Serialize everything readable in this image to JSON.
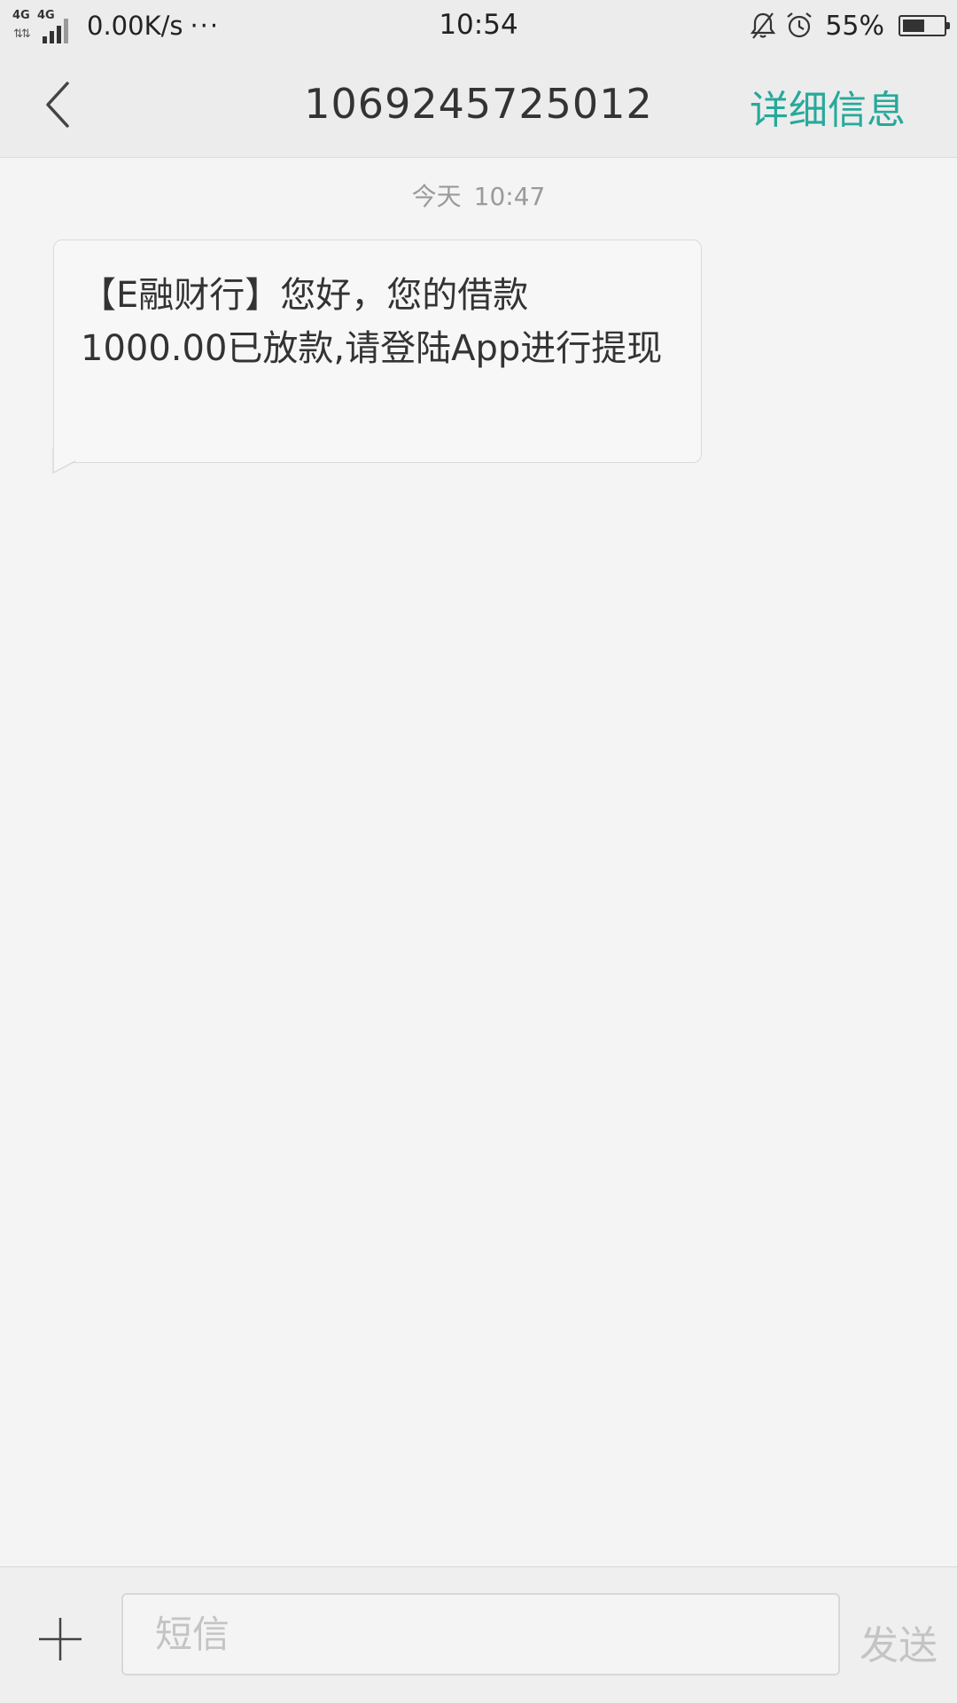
{
  "status_bar": {
    "network_label_1": "4G",
    "network_label_2": "4G",
    "network_arrows": "⇅⇅",
    "speed": "0.00K/s",
    "more": "···",
    "time": "10:54",
    "battery_percent": "55%",
    "battery_level": 0.55,
    "icons": [
      "signal-icon",
      "bell-mute-icon",
      "alarm-clock-icon",
      "battery-icon"
    ]
  },
  "header": {
    "back_icon": "chevron-left-icon",
    "title": "1069245725012",
    "detail_label": "详细信息"
  },
  "conversation": {
    "date_label": "今天",
    "time_label": "10:47",
    "messages": [
      {
        "direction": "incoming",
        "text": "【E融财行】您好，您的借款1000.00已放款,请登陆App进行提现"
      }
    ]
  },
  "composer": {
    "attach_icon": "plus-icon",
    "placeholder": "短信",
    "value": "",
    "send_label": "发送"
  },
  "colors": {
    "accent": "#27a99a",
    "background": "#f4f4f4",
    "bar_background": "#ececec",
    "disabled_text": "#c4c4c4"
  }
}
